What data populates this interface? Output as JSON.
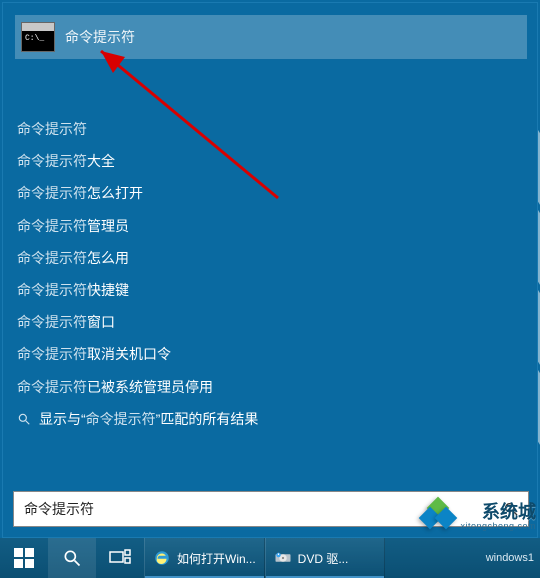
{
  "best_match": {
    "label": "命令提示符"
  },
  "suggestions": [
    {
      "prefix": "命令提示符",
      "suffix": ""
    },
    {
      "prefix": "命令提示符",
      "suffix": "大全"
    },
    {
      "prefix": "命令提示符",
      "suffix": "怎么打开"
    },
    {
      "prefix": "命令提示符",
      "suffix": "管理员"
    },
    {
      "prefix": "命令提示符",
      "suffix": "怎么用"
    },
    {
      "prefix": "命令提示符",
      "suffix": "快捷键"
    },
    {
      "prefix": "命令提示符",
      "suffix": "窗口"
    },
    {
      "prefix": "命令提示符",
      "suffix": "取消关机口令"
    },
    {
      "prefix": "命令提示符",
      "suffix": "已被系统管理员停用"
    }
  ],
  "search_all": {
    "before": "显示与",
    "quote_open": "“",
    "term": "命令提示符",
    "quote_close": "”",
    "after": "匹配的所有结果"
  },
  "search_box": {
    "value": "命令提示符",
    "placeholder": ""
  },
  "taskbar": {
    "apps": [
      {
        "label": "如何打开Win..."
      },
      {
        "label": "DVD 驱..."
      }
    ],
    "tray_label": "windows1"
  },
  "watermark": {
    "line1": "系统城",
    "line2": "xitongcheng.com"
  }
}
